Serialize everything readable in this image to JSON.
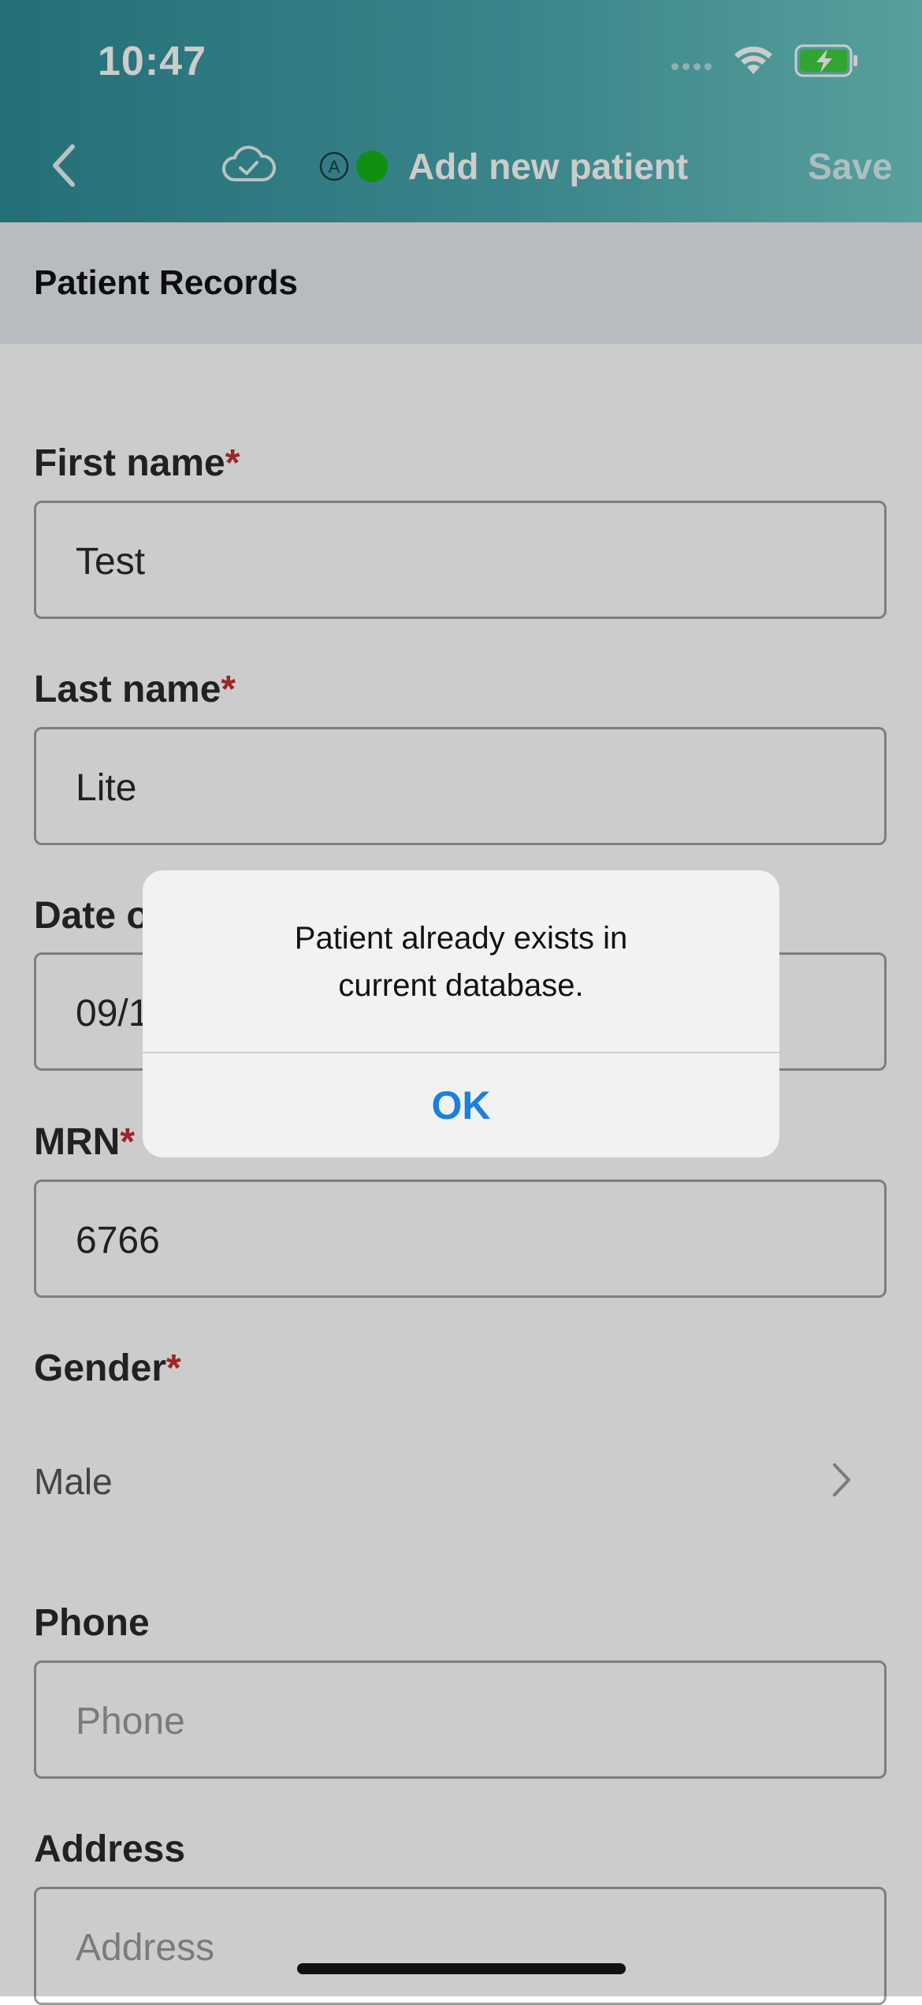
{
  "status_bar": {
    "time": "10:47"
  },
  "nav": {
    "title": "Add new patient",
    "save_label": "Save",
    "auto_label": "A"
  },
  "section": {
    "title": "Patient Records"
  },
  "form": {
    "first_name": {
      "label": "First name",
      "required_mark": "*",
      "value": "Test"
    },
    "last_name": {
      "label": "Last name",
      "required_mark": "*",
      "value": "Lite"
    },
    "date_of_birth": {
      "label": "Date of birth",
      "required_mark": "*",
      "value": "09/1"
    },
    "mrn": {
      "label": "MRN",
      "required_mark": "*",
      "value": "6766"
    },
    "gender": {
      "label": "Gender",
      "required_mark": "*",
      "value": "Male"
    },
    "phone": {
      "label": "Phone",
      "placeholder": "Phone"
    },
    "address": {
      "label": "Address",
      "placeholder": "Address"
    }
  },
  "alert": {
    "message_line1": "Patient already exists in",
    "message_line2": "current database.",
    "ok_label": "OK"
  },
  "colors": {
    "header_start": "#2e8c96",
    "header_end": "#6ec8c4",
    "status_dot": "#13b515",
    "required": "#c3302e",
    "alert_button": "#1a7fe0"
  }
}
